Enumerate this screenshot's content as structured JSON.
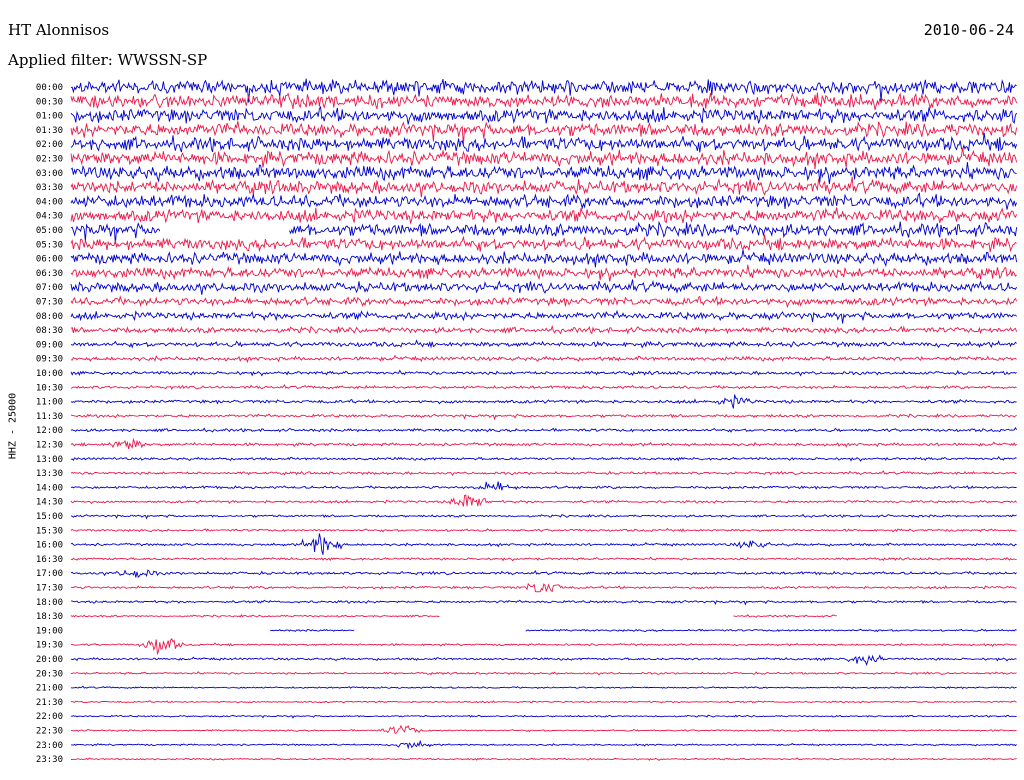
{
  "header": {
    "station": "HT Alonnisos",
    "date": "2010-06-24",
    "filter": "Applied filter: WWSSN-SP"
  },
  "axis": {
    "ylabel": "HHZ - 25000"
  },
  "chart_data": {
    "type": "line",
    "title": "HT Alonnisos",
    "date": "2010-06-24",
    "channel": "HHZ",
    "filter": "WWSSN-SP",
    "trace_minutes": 30,
    "row_colors": [
      "#0000cc",
      "#e8194a"
    ],
    "rows": [
      {
        "label": "00:00",
        "amplitude": 0.85,
        "events": []
      },
      {
        "label": "00:30",
        "amplitude": 0.85,
        "events": []
      },
      {
        "label": "01:00",
        "amplitude": 0.85,
        "events": []
      },
      {
        "label": "01:30",
        "amplitude": 0.85,
        "events": []
      },
      {
        "label": "02:00",
        "amplitude": 0.85,
        "events": []
      },
      {
        "label": "02:30",
        "amplitude": 0.85,
        "events": []
      },
      {
        "label": "03:00",
        "amplitude": 0.85,
        "events": []
      },
      {
        "label": "03:30",
        "amplitude": 0.8,
        "events": []
      },
      {
        "label": "04:00",
        "amplitude": 0.8,
        "events": []
      },
      {
        "label": "04:30",
        "amplitude": 0.8,
        "events": []
      },
      {
        "label": "05:00",
        "amplitude": 0.8,
        "events": [],
        "gaps": [
          [
            0.095,
            0.23
          ]
        ]
      },
      {
        "label": "05:30",
        "amplitude": 0.75,
        "events": []
      },
      {
        "label": "06:00",
        "amplitude": 0.7,
        "events": []
      },
      {
        "label": "06:30",
        "amplitude": 0.65,
        "events": []
      },
      {
        "label": "07:00",
        "amplitude": 0.6,
        "events": []
      },
      {
        "label": "07:30",
        "amplitude": 0.5,
        "events": []
      },
      {
        "label": "08:00",
        "amplitude": 0.45,
        "events": []
      },
      {
        "label": "08:30",
        "amplitude": 0.35,
        "events": []
      },
      {
        "label": "09:00",
        "amplitude": 0.3,
        "events": []
      },
      {
        "label": "09:30",
        "amplitude": 0.25,
        "events": []
      },
      {
        "label": "10:00",
        "amplitude": 0.2,
        "events": []
      },
      {
        "label": "10:30",
        "amplitude": 0.18,
        "events": []
      },
      {
        "label": "11:00",
        "amplitude": 0.2,
        "events": [
          {
            "pos": 0.7,
            "amp": 0.6
          }
        ]
      },
      {
        "label": "11:30",
        "amplitude": 0.18,
        "events": []
      },
      {
        "label": "12:00",
        "amplitude": 0.18,
        "events": []
      },
      {
        "label": "12:30",
        "amplitude": 0.18,
        "events": [
          {
            "pos": 0.06,
            "amp": 0.7
          }
        ]
      },
      {
        "label": "13:00",
        "amplitude": 0.16,
        "events": []
      },
      {
        "label": "13:30",
        "amplitude": 0.16,
        "events": []
      },
      {
        "label": "14:00",
        "amplitude": 0.16,
        "events": [
          {
            "pos": 0.45,
            "amp": 0.8
          }
        ]
      },
      {
        "label": "14:30",
        "amplitude": 0.15,
        "events": [
          {
            "pos": 0.42,
            "amp": 1.2
          }
        ]
      },
      {
        "label": "15:00",
        "amplitude": 0.14,
        "events": []
      },
      {
        "label": "15:30",
        "amplitude": 0.14,
        "events": []
      },
      {
        "label": "16:00",
        "amplitude": 0.15,
        "events": [
          {
            "pos": 0.265,
            "amp": 1.6
          },
          {
            "pos": 0.72,
            "amp": 0.5
          }
        ]
      },
      {
        "label": "16:30",
        "amplitude": 0.14,
        "events": []
      },
      {
        "label": "17:00",
        "amplitude": 0.17,
        "events": [
          {
            "pos": 0.07,
            "amp": 0.6
          }
        ]
      },
      {
        "label": "17:30",
        "amplitude": 0.15,
        "events": [
          {
            "pos": 0.5,
            "amp": 1.0
          }
        ]
      },
      {
        "label": "18:00",
        "amplitude": 0.15,
        "events": []
      },
      {
        "label": "18:30",
        "amplitude": 0.12,
        "events": [],
        "gaps": [
          [
            0.39,
            0.7
          ],
          [
            0.81,
            1.0
          ]
        ]
      },
      {
        "label": "19:00",
        "amplitude": 0.12,
        "events": [],
        "gaps": [
          [
            0.0,
            0.21
          ],
          [
            0.3,
            0.48
          ]
        ]
      },
      {
        "label": "19:30",
        "amplitude": 0.12,
        "events": [
          {
            "pos": 0.095,
            "amp": 1.3
          }
        ]
      },
      {
        "label": "20:00",
        "amplitude": 0.14,
        "events": [
          {
            "pos": 0.84,
            "amp": 0.7
          }
        ]
      },
      {
        "label": "20:30",
        "amplitude": 0.12,
        "events": []
      },
      {
        "label": "21:00",
        "amplitude": 0.1,
        "events": []
      },
      {
        "label": "21:30",
        "amplitude": 0.1,
        "events": []
      },
      {
        "label": "22:00",
        "amplitude": 0.1,
        "events": []
      },
      {
        "label": "22:30",
        "amplitude": 0.1,
        "events": [
          {
            "pos": 0.35,
            "amp": 0.7
          }
        ]
      },
      {
        "label": "23:00",
        "amplitude": 0.1,
        "events": [
          {
            "pos": 0.36,
            "amp": 0.5
          }
        ]
      },
      {
        "label": "23:30",
        "amplitude": 0.1,
        "events": []
      }
    ]
  }
}
